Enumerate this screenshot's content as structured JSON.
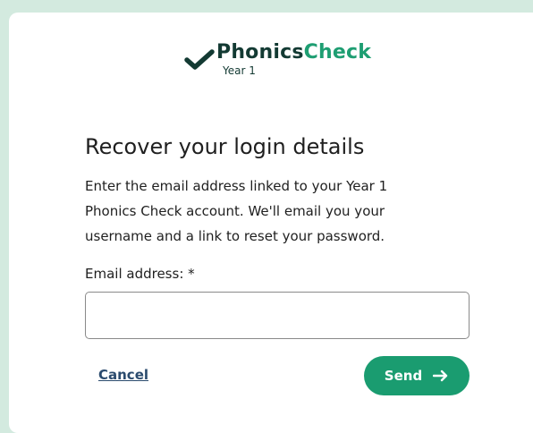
{
  "logo": {
    "brand_phonics": "Phonics",
    "brand_check": "Check",
    "subtitle": "Year 1",
    "icon": "checkmark-icon"
  },
  "form": {
    "title": "Recover your login details",
    "description_lines": [
      "Enter the email address linked to your Year 1",
      "Phonics Check account. We'll email you your",
      "username and a link to reset your password."
    ],
    "email_label": "Email address: *",
    "email_value": "",
    "cancel_label": "Cancel",
    "send_label": "Send",
    "send_icon": "arrow-right-icon"
  },
  "colors": {
    "page_background": "#d3eadf",
    "brand_dark": "#133a33",
    "brand_green": "#1e9e72",
    "button_green": "#1a9c70",
    "link": "#2b4b6e"
  }
}
